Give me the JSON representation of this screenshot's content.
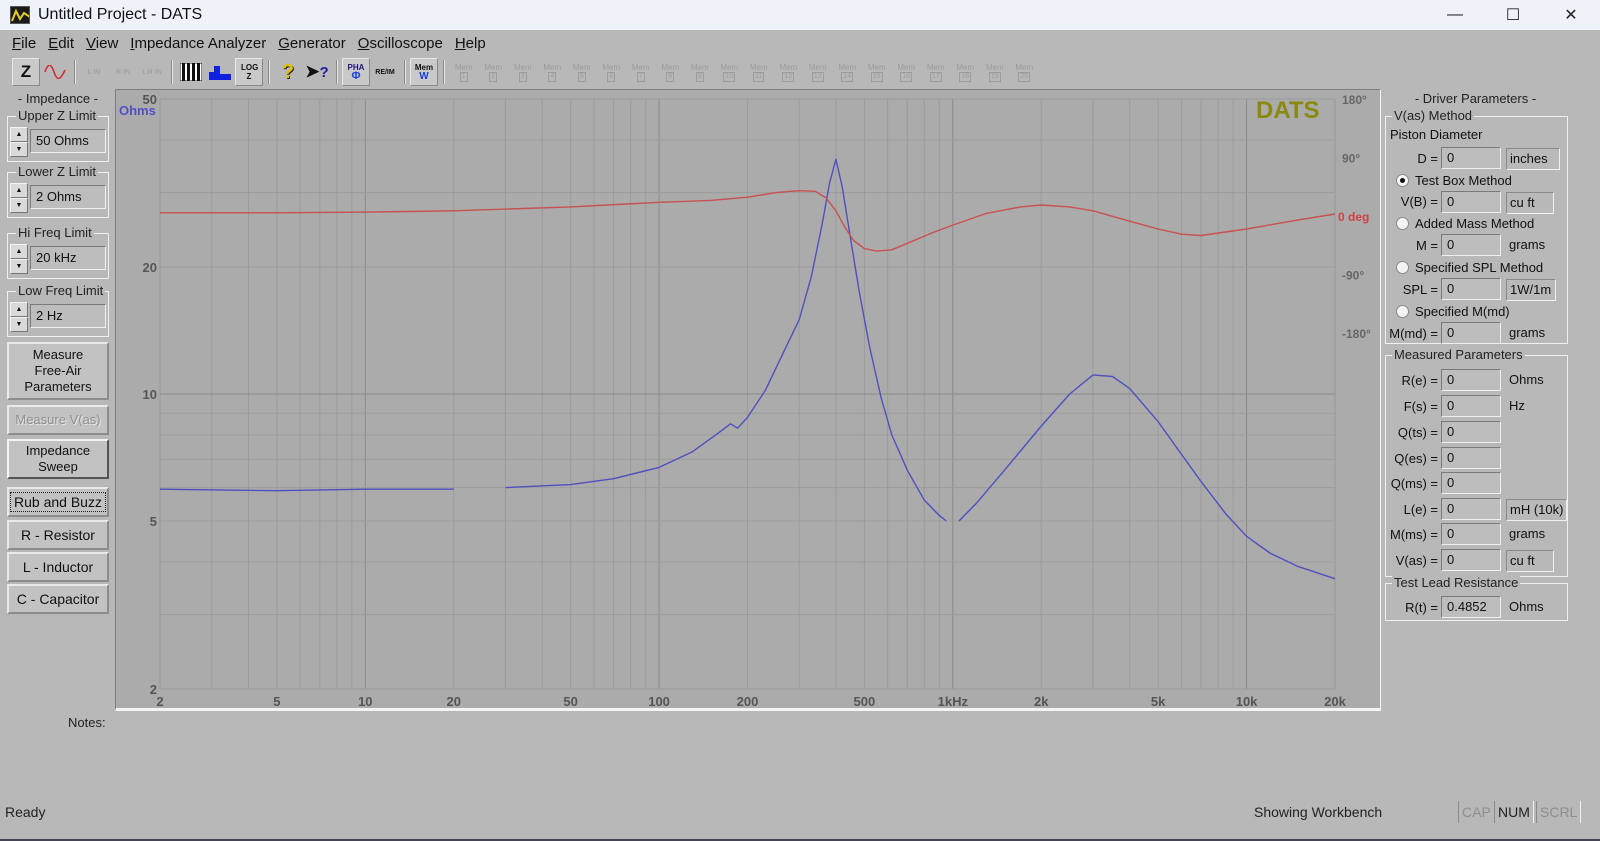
{
  "window": {
    "title": "Untitled Project - DATS",
    "controls": {
      "minimize": "—",
      "maximize": "☐",
      "close": "✕"
    }
  },
  "menu": [
    {
      "label": "File",
      "accel": "F",
      "rest": "ile"
    },
    {
      "label": "Edit",
      "accel": "E",
      "rest": "dit"
    },
    {
      "label": "View",
      "accel": "V",
      "rest": "iew"
    },
    {
      "label": "Impedance Analyzer",
      "accel": "I",
      "rest": "mpedance Analyzer"
    },
    {
      "label": "Generator",
      "accel": "G",
      "rest": "enerator"
    },
    {
      "label": "Oscilloscope",
      "accel": "O",
      "rest": "scilloscope"
    },
    {
      "label": "Help",
      "accel": "H",
      "rest": "elp"
    }
  ],
  "toolbar": {
    "impedance_mode": "Z",
    "generator_icon": "sine-wave-icon",
    "left_in": "L IN",
    "right_in": "R IN",
    "lr_in": "L R IN",
    "piano_icon": "piano-keys-icon",
    "bars_icon": "blue-bars-icon",
    "log_z": "LOG Z",
    "help_icon": "question-icon",
    "context_help_icon": "pointer-question-icon",
    "pha": "PHA",
    "pha_sub": "Φ",
    "reim": "RE/IM",
    "mem_w": "Mem",
    "mem_w_sub": "W",
    "mem_label": "Mem",
    "mem_slots": [
      "1",
      "2",
      "3",
      "4",
      "5",
      "6",
      "7",
      "8",
      "9",
      "10",
      "11",
      "12",
      "13",
      "14",
      "15",
      "16",
      "17",
      "18",
      "19",
      "20"
    ]
  },
  "left_panel": {
    "header": "- Impedance -",
    "upper_z": {
      "label": "Upper Z Limit",
      "value": "50 Ohms"
    },
    "lower_z": {
      "label": "Lower Z Limit",
      "value": "2 Ohms"
    },
    "hi_freq": {
      "label": "Hi Freq Limit",
      "value": "20 kHz"
    },
    "low_freq": {
      "label": "Low Freq Limit",
      "value": "2 Hz"
    },
    "buttons": {
      "measure_free_air_1": "Measure",
      "measure_free_air_2": "Free-Air",
      "measure_free_air_3": "Parameters",
      "measure_vas": "Measure V(as)",
      "impedance_sweep_1": "Impedance",
      "impedance_sweep_2": "Sweep",
      "rub_and_buzz": "Rub and Buzz",
      "resistor": "R - Resistor",
      "inductor": "L - Inductor",
      "capacitor": "C - Capacitor"
    }
  },
  "notes": {
    "label": "Notes:"
  },
  "right_panel": {
    "header": "- Driver Parameters -",
    "vas_method": {
      "title": "V(as) Method",
      "piston_diameter": "Piston Diameter",
      "d": {
        "label": "D =",
        "value": "0",
        "unit": "inches"
      },
      "test_box": {
        "label": "Test Box Method",
        "checked": true
      },
      "vb": {
        "label": "V(B) =",
        "value": "0",
        "unit": "cu ft"
      },
      "added_mass": {
        "label": "Added Mass Method",
        "checked": false
      },
      "m": {
        "label": "M =",
        "value": "0",
        "unit": "grams"
      },
      "specified_spl": {
        "label": "Specified SPL Method",
        "checked": false
      },
      "spl": {
        "label": "SPL =",
        "value": "0",
        "unit": "1W/1m"
      },
      "specified_mmd": {
        "label": "Specified M(md)",
        "checked": false
      },
      "mmd": {
        "label": "M(md) =",
        "value": "0",
        "unit": "grams"
      }
    },
    "measured": {
      "title": "Measured Parameters",
      "rows": [
        {
          "label": "R(e) =",
          "value": "0",
          "unit": "Ohms",
          "boxed": false
        },
        {
          "label": "F(s) =",
          "value": "0",
          "unit": "Hz",
          "boxed": false
        },
        {
          "label": "Q(ts) =",
          "value": "0",
          "unit": "",
          "boxed": false
        },
        {
          "label": "Q(es) =",
          "value": "0",
          "unit": "",
          "boxed": false
        },
        {
          "label": "Q(ms) =",
          "value": "0",
          "unit": "",
          "boxed": false
        },
        {
          "label": "L(e) =",
          "value": "0",
          "unit": "mH (10k)",
          "boxed": true
        },
        {
          "label": "M(ms) =",
          "value": "0",
          "unit": "grams",
          "boxed": false
        },
        {
          "label": "V(as) =",
          "value": "0",
          "unit": "cu ft",
          "boxed": true
        }
      ]
    },
    "test_lead": {
      "title": "Test Lead Resistance",
      "rt": {
        "label": "R(t) =",
        "value": "0.4852",
        "unit": "Ohms"
      }
    }
  },
  "status": {
    "ready": "Ready",
    "mode": "Showing Workbench",
    "cap": "CAP",
    "num": "NUM",
    "scrl": "SCRL"
  },
  "chart_data": {
    "type": "line",
    "title": "",
    "watermark": "DATS",
    "xlabel": "",
    "ylabel": "Ohms",
    "x_scale": "log",
    "y_scale": "log",
    "xlim": [
      2,
      20000
    ],
    "ylim": [
      2,
      50
    ],
    "y2lim": [
      -180,
      180
    ],
    "grid": true,
    "x_ticks": [
      {
        "value": 2,
        "label": "2"
      },
      {
        "value": 5,
        "label": "5"
      },
      {
        "value": 10,
        "label": "10"
      },
      {
        "value": 20,
        "label": "20"
      },
      {
        "value": 50,
        "label": "50"
      },
      {
        "value": 100,
        "label": "100"
      },
      {
        "value": 200,
        "label": "200"
      },
      {
        "value": 500,
        "label": "500"
      },
      {
        "value": 1000,
        "label": "1kHz"
      },
      {
        "value": 2000,
        "label": "2k"
      },
      {
        "value": 5000,
        "label": "5k"
      },
      {
        "value": 10000,
        "label": "10k"
      },
      {
        "value": 20000,
        "label": "20k"
      }
    ],
    "y_ticks": [
      {
        "value": 50,
        "label": "50"
      },
      {
        "value": 20,
        "label": "20"
      },
      {
        "value": 10,
        "label": "10"
      },
      {
        "value": 5,
        "label": "5"
      },
      {
        "value": 2,
        "label": "2"
      }
    ],
    "y2_ticks": [
      {
        "value": 180,
        "label": "180°"
      },
      {
        "value": 90,
        "label": "90°"
      },
      {
        "value": 0,
        "label": "0 deg"
      },
      {
        "value": -90,
        "label": "-90°"
      },
      {
        "value": -180,
        "label": "-180°"
      }
    ],
    "colors": {
      "impedance": "#5050c0",
      "phase": "#c85050",
      "axis_unit": "#5050c8",
      "zero_deg": "#d04040",
      "watermark": "#8a8a10"
    },
    "series": [
      {
        "name": "Impedance (Ohms)",
        "axis": "left",
        "segments": [
          {
            "x": [
              2,
              5,
              10,
              20
            ],
            "y": [
              5.95,
              5.9,
              5.95,
              5.95
            ]
          },
          {
            "x": [
              30,
              50,
              70,
              100,
              130,
              160,
              175,
              185,
              200,
              230,
              260,
              300,
              330,
              360,
              380,
              400,
              420,
              450,
              480,
              520,
              570,
              620,
              700,
              800,
              900,
              950
            ],
            "y": [
              6.0,
              6.1,
              6.3,
              6.7,
              7.3,
              8.1,
              8.5,
              8.3,
              8.8,
              10.2,
              12.2,
              15.0,
              19.0,
              25.5,
              31.5,
              36.0,
              31.0,
              23.0,
              17.5,
              13.0,
              9.8,
              8.0,
              6.6,
              5.6,
              5.15,
              5.0
            ]
          },
          {
            "x": [
              1050,
              1200,
              1500,
              2000,
              2500,
              3000,
              3500,
              4000,
              5000,
              6000,
              7000,
              8500,
              10000,
              12000,
              15000,
              20000
            ],
            "y": [
              5.0,
              5.5,
              6.6,
              8.4,
              10.0,
              11.1,
              11.0,
              10.3,
              8.6,
              7.2,
              6.2,
              5.2,
              4.6,
              4.2,
              3.9,
              3.65
            ]
          }
        ]
      },
      {
        "name": "Phase (deg)",
        "axis": "right",
        "segments": [
          {
            "x": [
              2,
              5,
              10,
              20,
              50,
              100,
              150,
              200,
              250,
              300,
              340,
              370,
              400,
              430,
              460,
              500,
              550,
              620,
              700,
              850,
              1000,
              1300,
              1700,
              2000,
              2500,
              3000,
              4000,
              5000,
              6000,
              7000,
              10000,
              15000,
              20000
            ],
            "y": [
              5,
              5,
              6,
              8,
              14,
              21,
              24,
              29,
              36,
              39,
              38,
              28,
              8,
              -18,
              -38,
              -50,
              -54,
              -52,
              -42,
              -26,
              -14,
              4,
              14,
              17,
              14,
              8,
              -8,
              -20,
              -28,
              -30,
              -20,
              -6,
              3
            ]
          }
        ]
      }
    ]
  }
}
